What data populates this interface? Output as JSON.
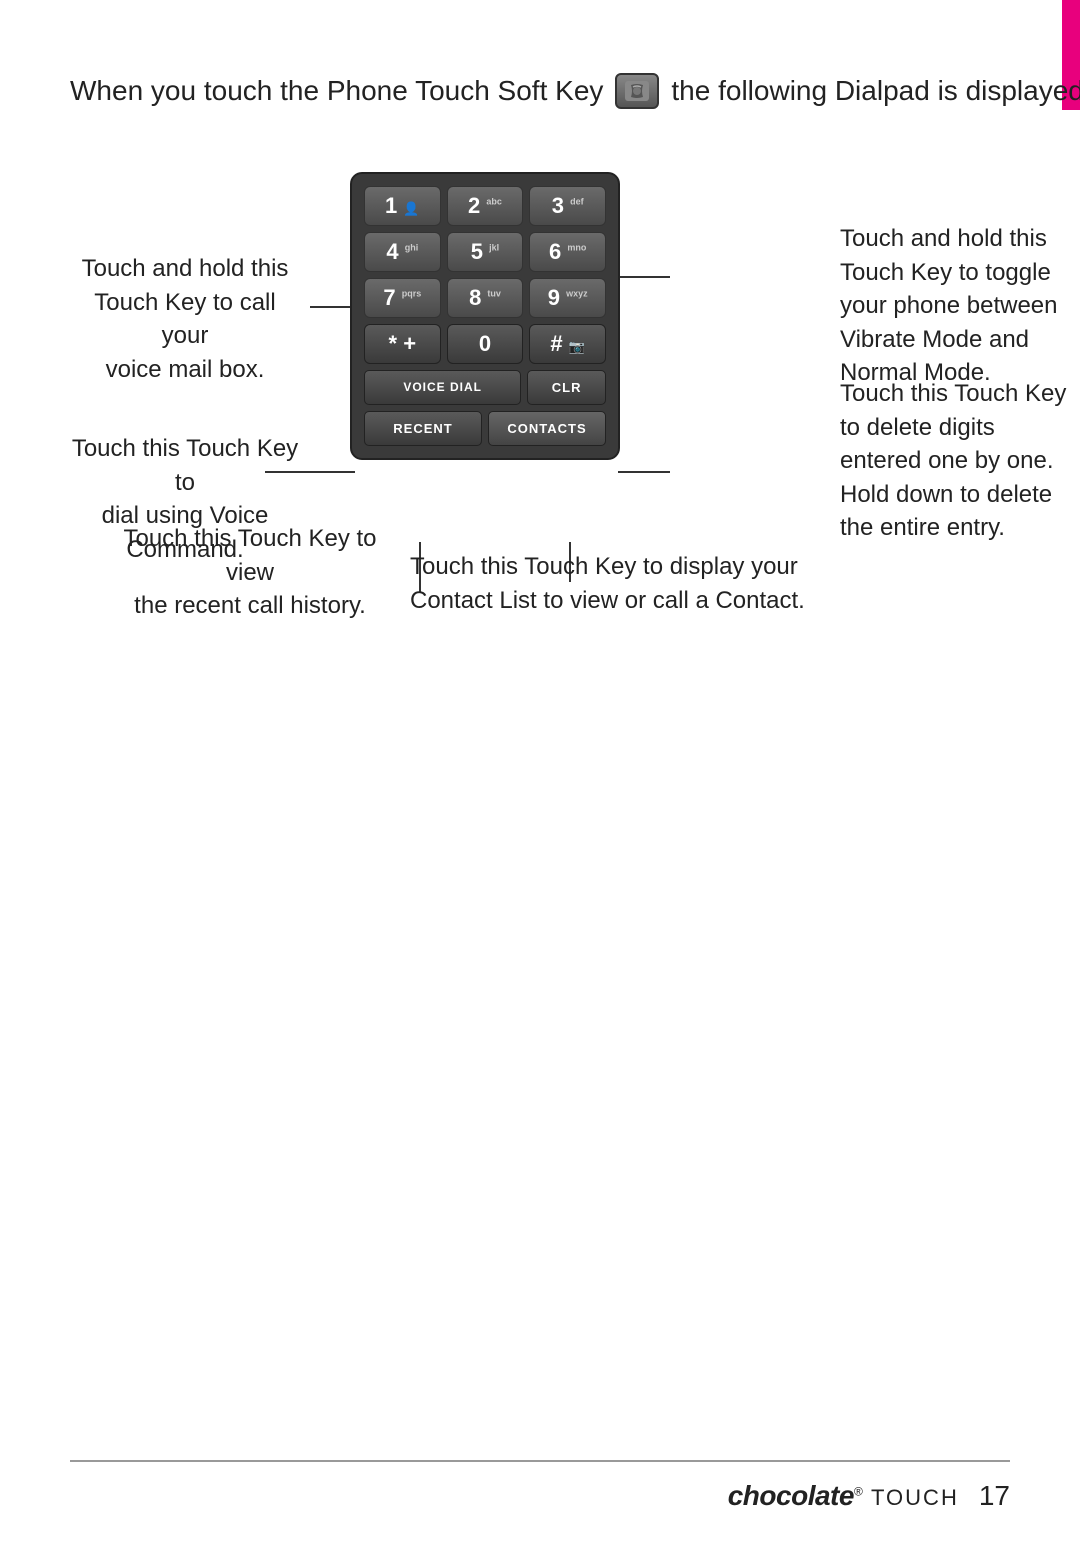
{
  "page": {
    "number": "17",
    "accent_color": "#e8007d"
  },
  "intro": {
    "text_before": "When you touch the Phone Touch Soft Key",
    "text_after": "the following Dialpad is displayed:",
    "icon_alt": "phone touch soft key icon"
  },
  "dialpad": {
    "keys": [
      {
        "main": "1",
        "sub": "",
        "special_icon": "person-wave"
      },
      {
        "main": "2",
        "sub": "abc"
      },
      {
        "main": "3",
        "sub": "def"
      },
      {
        "main": "4",
        "sub": "ghi"
      },
      {
        "main": "5",
        "sub": "jkl"
      },
      {
        "main": "6",
        "sub": "mno"
      },
      {
        "main": "7",
        "sub": "pqrs"
      },
      {
        "main": "8",
        "sub": "tuv"
      },
      {
        "main": "9",
        "sub": "wxyz"
      },
      {
        "main": "*",
        "sub": "+"
      },
      {
        "main": "0",
        "sub": ""
      },
      {
        "main": "#",
        "sub": ""
      }
    ],
    "buttons": {
      "voice_dial": "VOICE DIAL",
      "clr": "CLR",
      "recent": "RECENT",
      "contacts": "CONTACTS"
    }
  },
  "annotations": {
    "top_left": {
      "line1": "Touch and hold this",
      "line2": "Touch Key to call your",
      "line3": "voice mail box."
    },
    "top_right": {
      "line1": "Touch and hold this",
      "line2": "Touch Key to toggle",
      "line3": "your phone between",
      "line4": "Vibrate Mode and",
      "line5": "Normal Mode."
    },
    "middle_left": {
      "line1": "Touch this Touch Key to",
      "line2": "dial using Voice",
      "line3": "Command."
    },
    "middle_right": {
      "line1": "Touch this Touch Key",
      "line2": "to delete digits",
      "line3": "entered one by one.",
      "line4": "Hold down to delete",
      "line5": "the entire entry."
    },
    "bottom_left": {
      "line1": "Touch this Touch Key to view",
      "line2": "the recent call history."
    },
    "bottom_right": {
      "line1": "Touch this Touch Key to display your",
      "line2": "Contact List to view or call a Contact."
    }
  },
  "brand": {
    "name": "chocolate",
    "suffix": "TOUCH",
    "registered": "®"
  }
}
